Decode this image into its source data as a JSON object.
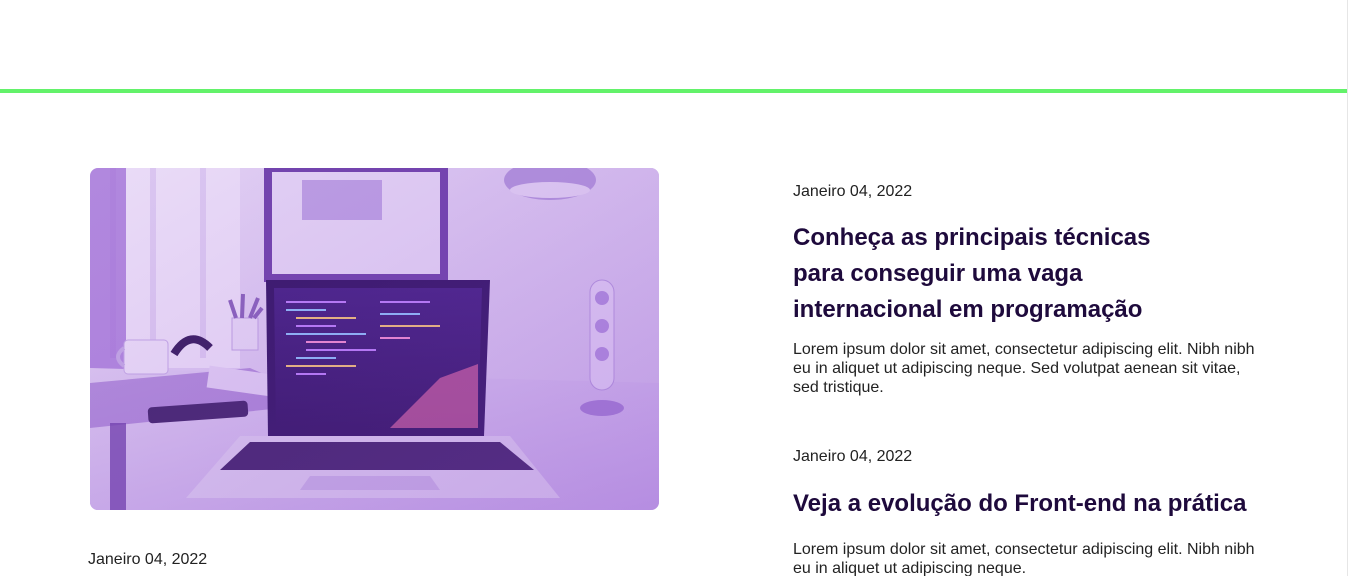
{
  "featured": {
    "date": "Janeiro 04, 2022",
    "image": "laptop-on-desk-photo"
  },
  "posts": [
    {
      "date": "Janeiro 04, 2022",
      "title": "Conheça as principais técnicas para conseguir uma vaga internacional em programação",
      "excerpt": "Lorem ipsum dolor sit amet, consectetur adipiscing elit. Nibh nibh eu in aliquet ut adipiscing neque. Sed volutpat aenean sit vitae, sed tristique."
    },
    {
      "date": "Janeiro 04, 2022",
      "title": "Veja a evolução do Front-end na prática",
      "excerpt": "Lorem ipsum dolor sit amet, consectetur adipiscing elit. Nibh nibh eu in aliquet ut adipiscing neque."
    }
  ],
  "colors": {
    "accent_divider": "#63f26a",
    "title": "#1e0a3c",
    "text": "#222222",
    "image_tint": "#8a3fd1"
  }
}
